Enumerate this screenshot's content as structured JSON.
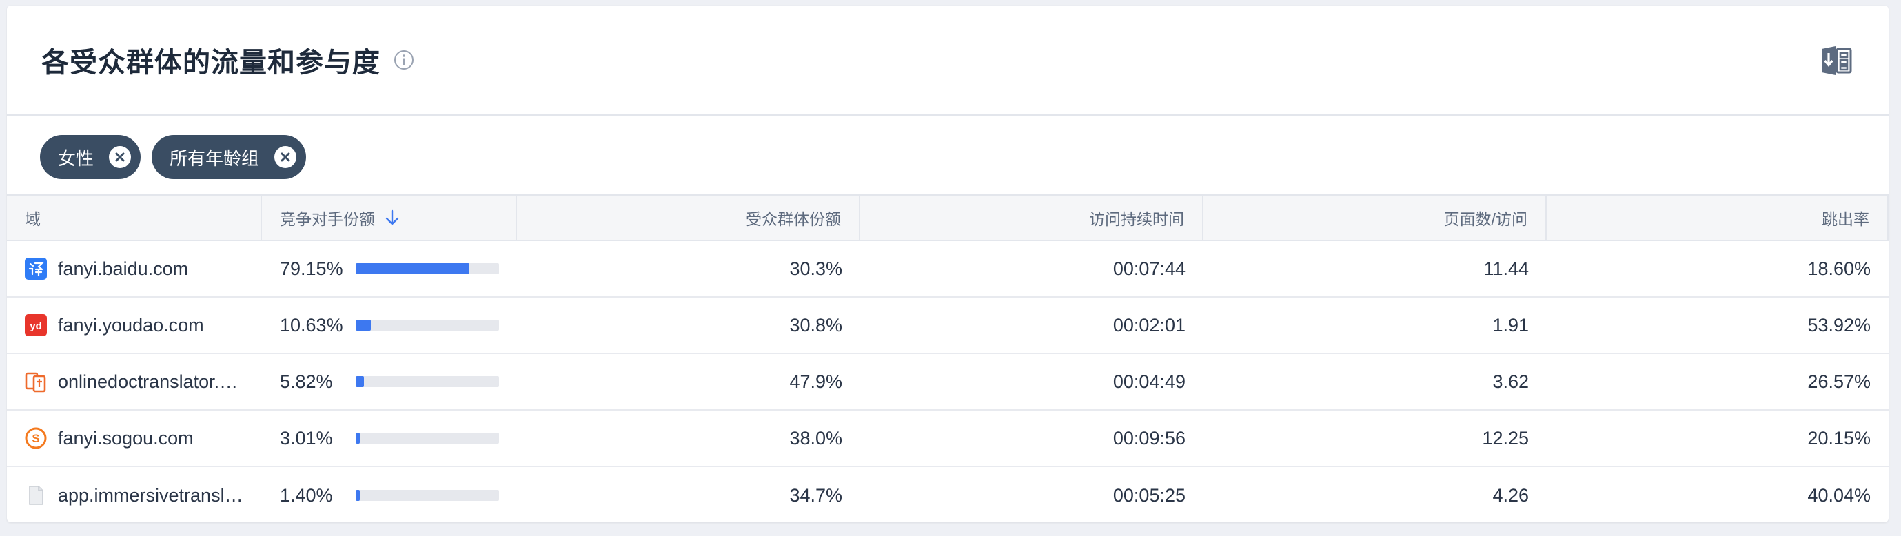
{
  "header": {
    "title": "各受众群体的流量和参与度",
    "info_icon": "info-circle-icon",
    "export_icon": "excel-export-icon"
  },
  "filters": [
    {
      "label": "女性",
      "icon": "close-icon"
    },
    {
      "label": "所有年龄组",
      "icon": "close-icon"
    }
  ],
  "table": {
    "columns": {
      "domain": "域",
      "competitor_share": "竞争对手份额",
      "audience_share": "受众群体份额",
      "visit_duration": "访问持续时间",
      "pages_per_visit": "页面数/访问",
      "bounce_rate": "跳出率"
    },
    "sort_icon": "arrow-down-icon",
    "rows": [
      {
        "domain": "fanyi.baidu.com",
        "icon": "baidu-translate-icon",
        "competitor_share": "79.15%",
        "share_fraction": 0.7915,
        "audience_share": "30.3%",
        "visit_duration": "00:07:44",
        "pages_per_visit": "11.44",
        "bounce_rate": "18.60%"
      },
      {
        "domain": "fanyi.youdao.com",
        "icon": "youdao-icon",
        "competitor_share": "10.63%",
        "share_fraction": 0.1063,
        "audience_share": "30.8%",
        "visit_duration": "00:02:01",
        "pages_per_visit": "1.91",
        "bounce_rate": "53.92%"
      },
      {
        "domain": "onlinedoctranslator.com",
        "icon": "onlinedoctranslator-icon",
        "competitor_share": "5.82%",
        "share_fraction": 0.0582,
        "audience_share": "47.9%",
        "visit_duration": "00:04:49",
        "pages_per_visit": "3.62",
        "bounce_rate": "26.57%"
      },
      {
        "domain": "fanyi.sogou.com",
        "icon": "sogou-icon",
        "competitor_share": "3.01%",
        "share_fraction": 0.0301,
        "audience_share": "38.0%",
        "visit_duration": "00:09:56",
        "pages_per_visit": "12.25",
        "bounce_rate": "20.15%"
      },
      {
        "domain": "app.immersivetranslate.com",
        "icon": "generic-page-icon",
        "competitor_share": "1.40%",
        "share_fraction": 0.014,
        "audience_share": "34.7%",
        "visit_duration": "00:05:25",
        "pages_per_visit": "4.26",
        "bounce_rate": "40.04%"
      }
    ]
  },
  "colors": {
    "bar_fill": "#3d78f0",
    "bar_track": "#e6e8ed",
    "chip_bg": "#3a4d63",
    "sort_arrow": "#3d78f0"
  }
}
